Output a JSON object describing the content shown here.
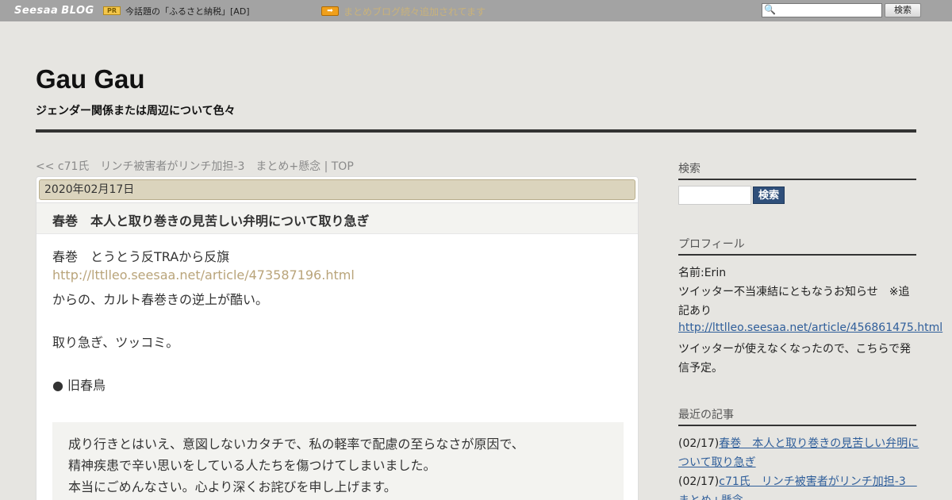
{
  "topbar": {
    "logo_seesaa": "Seesaa",
    "logo_blog": "BLOG",
    "pr_badge": "PR",
    "pr_text": "今話題の「ふるさと納税」[AD]",
    "news_icon": "arrow-right-icon",
    "news_text": "まとめブログ続々追加されてます",
    "search_button": "検索"
  },
  "header": {
    "title": "Gau Gau",
    "description": "ジェンダー関係または周辺について色々"
  },
  "nav": {
    "prev": "<< c71氏　リンチ被害者がリンチ加担-3　まとめ+懸念",
    "separator": " | ",
    "top": "TOP"
  },
  "post": {
    "date": "2020年02月17日",
    "title": "春巻　本人と取り巻きの見苦しい弁明について取り急ぎ",
    "line1": "春巻　とうとう反TRAから反旗",
    "link1": "http://lttlleo.seesaa.net/article/473587196.html",
    "line2": "からの、カルト春巻きの逆上が酷い。",
    "line3": "取り急ぎ、ツッコミ。",
    "line4": "● 旧春鳥",
    "quote": [
      "成り行きとはいえ、意図しないカタチで、私の軽率で配慮の至らなさが原因で、",
      "精神疾患で辛い思いをしている人たちを傷つけてしまいました。",
      "本当にごめんなさい。心より深くお詫びを申し上げます。"
    ]
  },
  "sidebar": {
    "search_heading": "検索",
    "search_button": "検索",
    "profile_heading": "プロフィール",
    "profile_name": "名前:Erin",
    "profile_notice_1": "ツイッター不当凍結にともなうお知らせ　※追",
    "profile_notice_2": "記あり",
    "profile_link": "http://lttlleo.seesaa.net/article/456861475.html",
    "profile_after_1": "ツイッターが使えなくなったので、こちらで発",
    "profile_after_2": "信予定。",
    "recent_heading": "最近の記事",
    "recent_1_date": "(02/17)",
    "recent_1_title_a": "春巻　本人と取り巻きの見苦しい弁明に",
    "recent_1_title_b": "ついて取り急ぎ",
    "recent_2_date": "(02/17)",
    "recent_2_title_a": "c71氏　リンチ被害者がリンチ加担-3　",
    "recent_2_title_b": "まとめ+懸念"
  },
  "colors": {
    "page_bg": "#e6e5e1",
    "topbar_bg": "#a3a3a3",
    "date_bar": "#dbd4bd",
    "link_blue": "#2f5e9a",
    "link_tan": "#b9a47a",
    "search_btn": "#2f4f7a"
  }
}
